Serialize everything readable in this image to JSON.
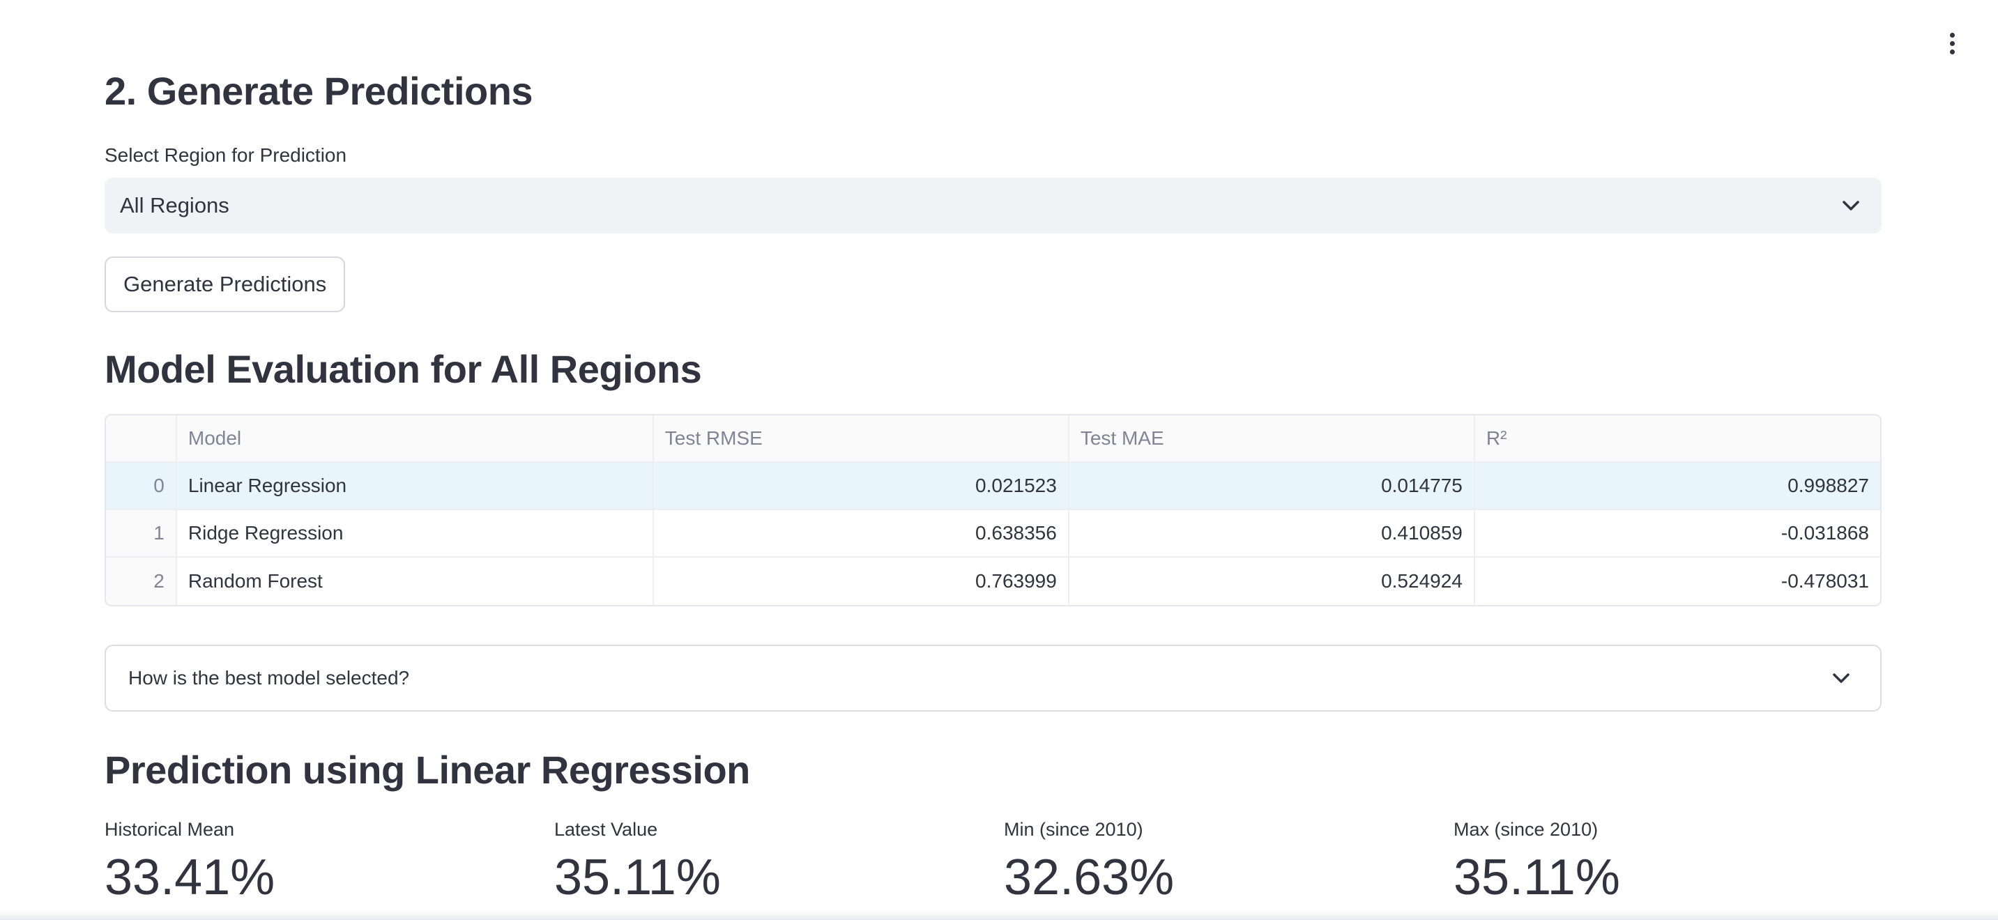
{
  "section_generate": {
    "title": "2. Generate Predictions"
  },
  "region_select": {
    "label": "Select Region for Prediction",
    "value": "All Regions"
  },
  "generate_button": {
    "label": "Generate Predictions"
  },
  "evaluation": {
    "title": "Model Evaluation for All Regions",
    "columns": [
      "",
      "Model",
      "Test RMSE",
      "Test MAE",
      "R²"
    ],
    "rows": [
      {
        "index": "0",
        "model": "Linear Regression",
        "rmse": "0.021523",
        "mae": "0.014775",
        "r2": "0.998827"
      },
      {
        "index": "1",
        "model": "Ridge Regression",
        "rmse": "0.638356",
        "mae": "0.410859",
        "r2": "-0.031868"
      },
      {
        "index": "2",
        "model": "Random Forest",
        "rmse": "0.763999",
        "mae": "0.524924",
        "r2": "-0.478031"
      }
    ]
  },
  "expander": {
    "label": "How is the best model selected?"
  },
  "prediction": {
    "title": "Prediction using Linear Regression",
    "metrics": [
      {
        "label": "Historical Mean",
        "value": "33.41%"
      },
      {
        "label": "Latest Value",
        "value": "35.11%"
      },
      {
        "label": "Min (since 2010)",
        "value": "32.63%"
      },
      {
        "label": "Max (since 2010)",
        "value": "35.11%"
      }
    ]
  },
  "colors": {
    "text": "#31333f",
    "select_bg": "#f0f2f6",
    "row_highlight": "#e9f5fd",
    "border": "#e6e7ec"
  }
}
